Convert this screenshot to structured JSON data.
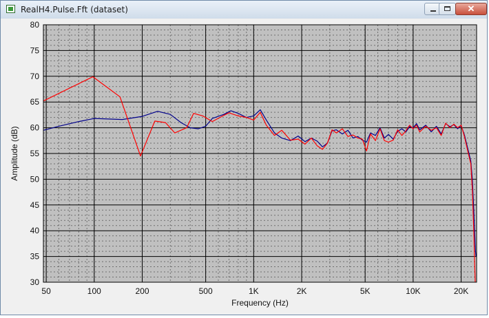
{
  "window": {
    "title": "RealH4.Pulse.Fft (dataset)",
    "icon": "dataset-window-icon",
    "controls": {
      "minimize": "minimize-icon",
      "maximize": "maximize-icon",
      "close": "✕"
    }
  },
  "chart_data": {
    "type": "line",
    "title": "",
    "xlabel": "Frequency (Hz)",
    "ylabel": "Amplitude (dB)",
    "x_scale": "log",
    "xlim": [
      48,
      25000
    ],
    "ylim": [
      30,
      80
    ],
    "yticks": [
      30,
      35,
      40,
      45,
      50,
      55,
      60,
      65,
      70,
      75,
      80
    ],
    "xticks": [
      {
        "value": 50,
        "label": "50"
      },
      {
        "value": 100,
        "label": "100"
      },
      {
        "value": 200,
        "label": "200"
      },
      {
        "value": 500,
        "label": "500"
      },
      {
        "value": 1000,
        "label": "1K"
      },
      {
        "value": 2000,
        "label": "2K"
      },
      {
        "value": 5000,
        "label": "5K"
      },
      {
        "value": 10000,
        "label": "10K"
      },
      {
        "value": 20000,
        "label": "20K"
      }
    ],
    "grid": true,
    "background": "#c0c0c0",
    "series": [
      {
        "color": "#00008b",
        "points": [
          [
            48,
            59.5
          ],
          [
            60,
            60.3
          ],
          [
            80,
            61.2
          ],
          [
            100,
            61.8
          ],
          [
            150,
            61.6
          ],
          [
            200,
            62.2
          ],
          [
            250,
            63.2
          ],
          [
            300,
            62.6
          ],
          [
            350,
            61.0
          ],
          [
            400,
            60.0
          ],
          [
            450,
            59.8
          ],
          [
            500,
            60.3
          ],
          [
            550,
            61.8
          ],
          [
            650,
            62.6
          ],
          [
            720,
            63.3
          ],
          [
            800,
            62.8
          ],
          [
            900,
            62.0
          ],
          [
            1000,
            62.3
          ],
          [
            1100,
            63.5
          ],
          [
            1200,
            61.5
          ],
          [
            1350,
            59.0
          ],
          [
            1500,
            58.0
          ],
          [
            1700,
            57.5
          ],
          [
            1900,
            58.4
          ],
          [
            2100,
            57.3
          ],
          [
            2300,
            58.0
          ],
          [
            2500,
            57.4
          ],
          [
            2700,
            56.3
          ],
          [
            2900,
            57.0
          ],
          [
            3100,
            59.4
          ],
          [
            3300,
            59.6
          ],
          [
            3600,
            58.8
          ],
          [
            3900,
            59.5
          ],
          [
            4200,
            58.0
          ],
          [
            4500,
            58.3
          ],
          [
            4800,
            57.6
          ],
          [
            5100,
            57.2
          ],
          [
            5400,
            59.0
          ],
          [
            5800,
            58.5
          ],
          [
            6200,
            60.0
          ],
          [
            6600,
            58.0
          ],
          [
            7000,
            58.7
          ],
          [
            7500,
            57.8
          ],
          [
            8000,
            59.3
          ],
          [
            8500,
            59.8
          ],
          [
            9000,
            59.2
          ],
          [
            9500,
            60.2
          ],
          [
            10000,
            60.0
          ],
          [
            10500,
            60.8
          ],
          [
            11000,
            59.6
          ],
          [
            12000,
            60.5
          ],
          [
            13000,
            59.2
          ],
          [
            14000,
            60.3
          ],
          [
            15000,
            58.8
          ],
          [
            16000,
            60.8
          ],
          [
            17000,
            60.2
          ],
          [
            18000,
            60.6
          ],
          [
            19000,
            59.8
          ],
          [
            20000,
            60.4
          ],
          [
            21000,
            58.5
          ],
          [
            22000,
            56.0
          ],
          [
            23000,
            53.5
          ],
          [
            23500,
            50.0
          ],
          [
            24000,
            44.0
          ],
          [
            24300,
            40.0
          ],
          [
            24600,
            36.0
          ],
          [
            24800,
            35.0
          ]
        ]
      },
      {
        "color": "#ff0000",
        "points": [
          [
            48,
            65.2
          ],
          [
            98,
            69.9
          ],
          [
            145,
            66.0
          ],
          [
            195,
            54.5
          ],
          [
            240,
            61.3
          ],
          [
            280,
            61.0
          ],
          [
            320,
            59.0
          ],
          [
            380,
            60.0
          ],
          [
            420,
            62.8
          ],
          [
            480,
            62.3
          ],
          [
            550,
            61.2
          ],
          [
            650,
            62.4
          ],
          [
            700,
            62.9
          ],
          [
            800,
            62.3
          ],
          [
            900,
            62.0
          ],
          [
            1000,
            61.5
          ],
          [
            1100,
            63.0
          ],
          [
            1200,
            60.5
          ],
          [
            1350,
            58.5
          ],
          [
            1500,
            59.5
          ],
          [
            1700,
            57.6
          ],
          [
            1900,
            57.8
          ],
          [
            2100,
            56.8
          ],
          [
            2300,
            58.0
          ],
          [
            2500,
            56.5
          ],
          [
            2700,
            55.8
          ],
          [
            2900,
            57.0
          ],
          [
            3100,
            59.6
          ],
          [
            3300,
            59.0
          ],
          [
            3600,
            59.8
          ],
          [
            3900,
            58.3
          ],
          [
            4200,
            58.6
          ],
          [
            4500,
            58.0
          ],
          [
            4800,
            57.8
          ],
          [
            5100,
            55.5
          ],
          [
            5400,
            58.8
          ],
          [
            5800,
            57.5
          ],
          [
            6200,
            59.8
          ],
          [
            6600,
            57.5
          ],
          [
            7000,
            57.2
          ],
          [
            7500,
            57.6
          ],
          [
            8000,
            59.6
          ],
          [
            8500,
            58.5
          ],
          [
            9000,
            59.4
          ],
          [
            9500,
            60.5
          ],
          [
            10000,
            59.8
          ],
          [
            10500,
            60.5
          ],
          [
            11000,
            59.2
          ],
          [
            12000,
            60.3
          ],
          [
            13000,
            59.5
          ],
          [
            14000,
            60.0
          ],
          [
            15000,
            58.5
          ],
          [
            16000,
            60.9
          ],
          [
            17000,
            60.0
          ],
          [
            18000,
            60.7
          ],
          [
            19000,
            60.0
          ],
          [
            20000,
            60.5
          ],
          [
            21000,
            58.2
          ],
          [
            22000,
            55.5
          ],
          [
            23000,
            53.0
          ],
          [
            23500,
            48.0
          ],
          [
            24000,
            40.0
          ],
          [
            24300,
            34.0
          ],
          [
            24500,
            30.0
          ]
        ]
      }
    ]
  }
}
